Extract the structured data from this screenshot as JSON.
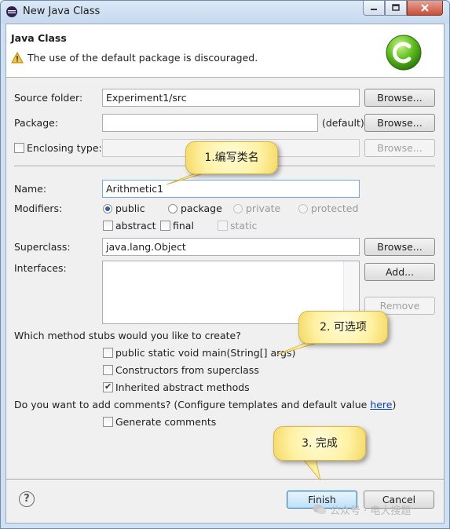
{
  "window": {
    "title": "New Java Class",
    "header_title": "Java Class",
    "header_message": "The use of the default package is discouraged."
  },
  "form": {
    "source_folder": {
      "label": "Source folder:",
      "value": "Experiment1/src",
      "browse": "Browse..."
    },
    "package": {
      "label": "Package:",
      "value": "",
      "suffix": "(default)",
      "browse": "Browse..."
    },
    "enclosing_type": {
      "label": "Enclosing type:",
      "value": "",
      "checked": false,
      "browse": "Browse..."
    },
    "name": {
      "label": "Name:",
      "value": "Arithmetic1"
    },
    "modifiers": {
      "label": "Modifiers:",
      "access": [
        "public",
        "package",
        "private",
        "protected"
      ],
      "selected": "public",
      "abstract": "abstract",
      "final": "final",
      "static": "static"
    },
    "superclass": {
      "label": "Superclass:",
      "value": "java.lang.Object",
      "browse": "Browse..."
    },
    "interfaces": {
      "label": "Interfaces:",
      "add": "Add...",
      "remove": "Remove"
    },
    "stubs": {
      "question": "Which method stubs would you like to create?",
      "items": [
        {
          "label": "public static void main(String[] args)",
          "checked": false
        },
        {
          "label": "Constructors from superclass",
          "checked": false
        },
        {
          "label": "Inherited abstract methods",
          "checked": true
        }
      ]
    },
    "comments": {
      "question_prefix": "Do you want to add comments? (Configure templates and default value ",
      "link": "here",
      "question_suffix": ")",
      "generate": "Generate comments",
      "checked": false
    }
  },
  "footer": {
    "help": "?",
    "finish": "Finish",
    "cancel": "Cancel"
  },
  "callouts": {
    "c1": "1.编写类名",
    "c2": "2. 可选项",
    "c3": "3. 完成"
  },
  "watermark": "公众号 · 电大搜题",
  "colors": {
    "callout_fill": "#fff1a2",
    "link": "#0645ad",
    "radio_dot": "#2d5da5"
  }
}
